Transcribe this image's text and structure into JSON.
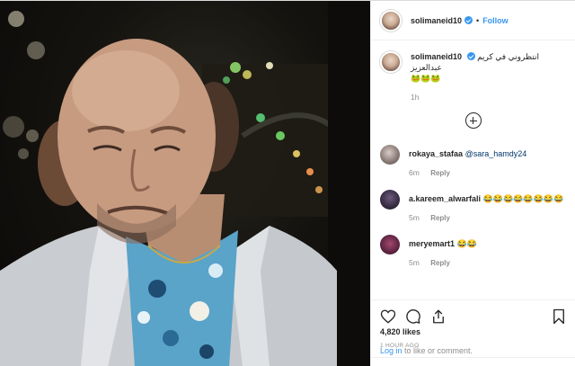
{
  "post": {
    "username": "solimaneid10",
    "follow_label": "Follow",
    "separator": "•"
  },
  "caption": {
    "username": "solimaneid10",
    "text": "انتظروني في كريم عبدالعزيز",
    "text2": "🐸🐸🐸",
    "time": "1h"
  },
  "comments": [
    {
      "username": "rokaya_stafaa",
      "mention": "@sara_hamdy24",
      "text": "",
      "time": "6m",
      "reply": "Reply"
    },
    {
      "username": "a.kareem_alwarfali",
      "mention": "",
      "text": "😂😂😂😂😂😂😂😂",
      "time": "5m",
      "reply": "Reply"
    },
    {
      "username": "meryemart1",
      "mention": "",
      "text": "😂😂",
      "time": "5m",
      "reply": "Reply"
    }
  ],
  "footer": {
    "likes": "4,820 likes",
    "ago": "1 HOUR AGO",
    "login_link": "Log in",
    "login_rest": " to like or comment."
  },
  "icons": [
    "heart-icon",
    "comment-icon",
    "share-icon",
    "bookmark-icon",
    "add-comment-icon",
    "verified-badge-icon"
  ],
  "colors": {
    "accent": "#3897f0",
    "muted": "#8e8e8e",
    "text": "#262626"
  }
}
